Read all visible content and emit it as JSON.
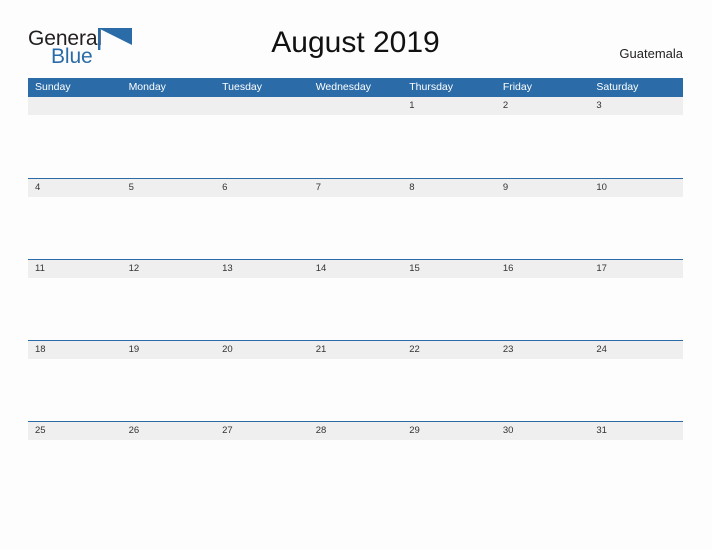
{
  "brand": {
    "name_part1": "General",
    "name_part2": "Blue",
    "flag_icon": "blue-flag-triangle-icon",
    "color_dark": "#231f20",
    "color_blue": "#2b6ca8"
  },
  "header": {
    "title": "August 2019",
    "month": "August",
    "year": "2019",
    "locale": "Guatemala"
  },
  "theme": {
    "header_blue": "#2b6ca8",
    "date_band_gray": "#efefef",
    "page_background": "#fdfdfd",
    "rule_blue": "#2b6ca8",
    "text_dark": "#333333",
    "weekday_text": "#ffffff"
  },
  "calendar": {
    "weekdays": [
      "Sunday",
      "Monday",
      "Tuesday",
      "Wednesday",
      "Thursday",
      "Friday",
      "Saturday"
    ],
    "weeks": [
      {
        "has_top_rule": false,
        "days": [
          "",
          "",
          "",
          "",
          "1",
          "2",
          "3"
        ]
      },
      {
        "has_top_rule": true,
        "days": [
          "4",
          "5",
          "6",
          "7",
          "8",
          "9",
          "10"
        ]
      },
      {
        "has_top_rule": true,
        "days": [
          "11",
          "12",
          "13",
          "14",
          "15",
          "16",
          "17"
        ]
      },
      {
        "has_top_rule": true,
        "days": [
          "18",
          "19",
          "20",
          "21",
          "22",
          "23",
          "24"
        ]
      },
      {
        "has_top_rule": true,
        "days": [
          "25",
          "26",
          "27",
          "28",
          "29",
          "30",
          "31"
        ]
      }
    ]
  }
}
